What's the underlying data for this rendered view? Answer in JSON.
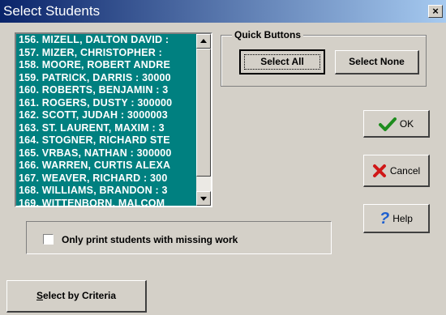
{
  "window": {
    "title": "Select Students",
    "close_label": "×"
  },
  "students": [
    "156. MIZELL, DALTON DAVID :",
    "157. MIZER, CHRISTOPHER :",
    "158. MOORE, ROBERT ANDRE",
    "159. PATRICK, DARRIS : 30000",
    "160. ROBERTS, BENJAMIN : 3",
    "161. ROGERS, DUSTY : 300000",
    "162. SCOTT, JUDAH : 3000003",
    "163. ST. LAURENT, MAXIM : 3",
    "164. STOGNER, RICHARD STE",
    "165. VRBAS, NATHAN : 300000",
    "166. WARREN, CURTIS ALEXA",
    "167. WEAVER, RICHARD : 300",
    "168. WILLIAMS, BRANDON : 3",
    "169. WITTENBORN, MALCOM"
  ],
  "quick_buttons": {
    "title": "Quick Buttons",
    "select_all": "Select All",
    "select_none": "Select None"
  },
  "actions": {
    "ok": "OK",
    "cancel": "Cancel",
    "help": "Help"
  },
  "missing_work": {
    "label": "Only print students with missing work",
    "checked": false
  },
  "criteria": {
    "label_first": "S",
    "label_rest": "elect by Criteria"
  },
  "colors": {
    "list_bg": "#008080",
    "title_bg": "#0a246a"
  }
}
